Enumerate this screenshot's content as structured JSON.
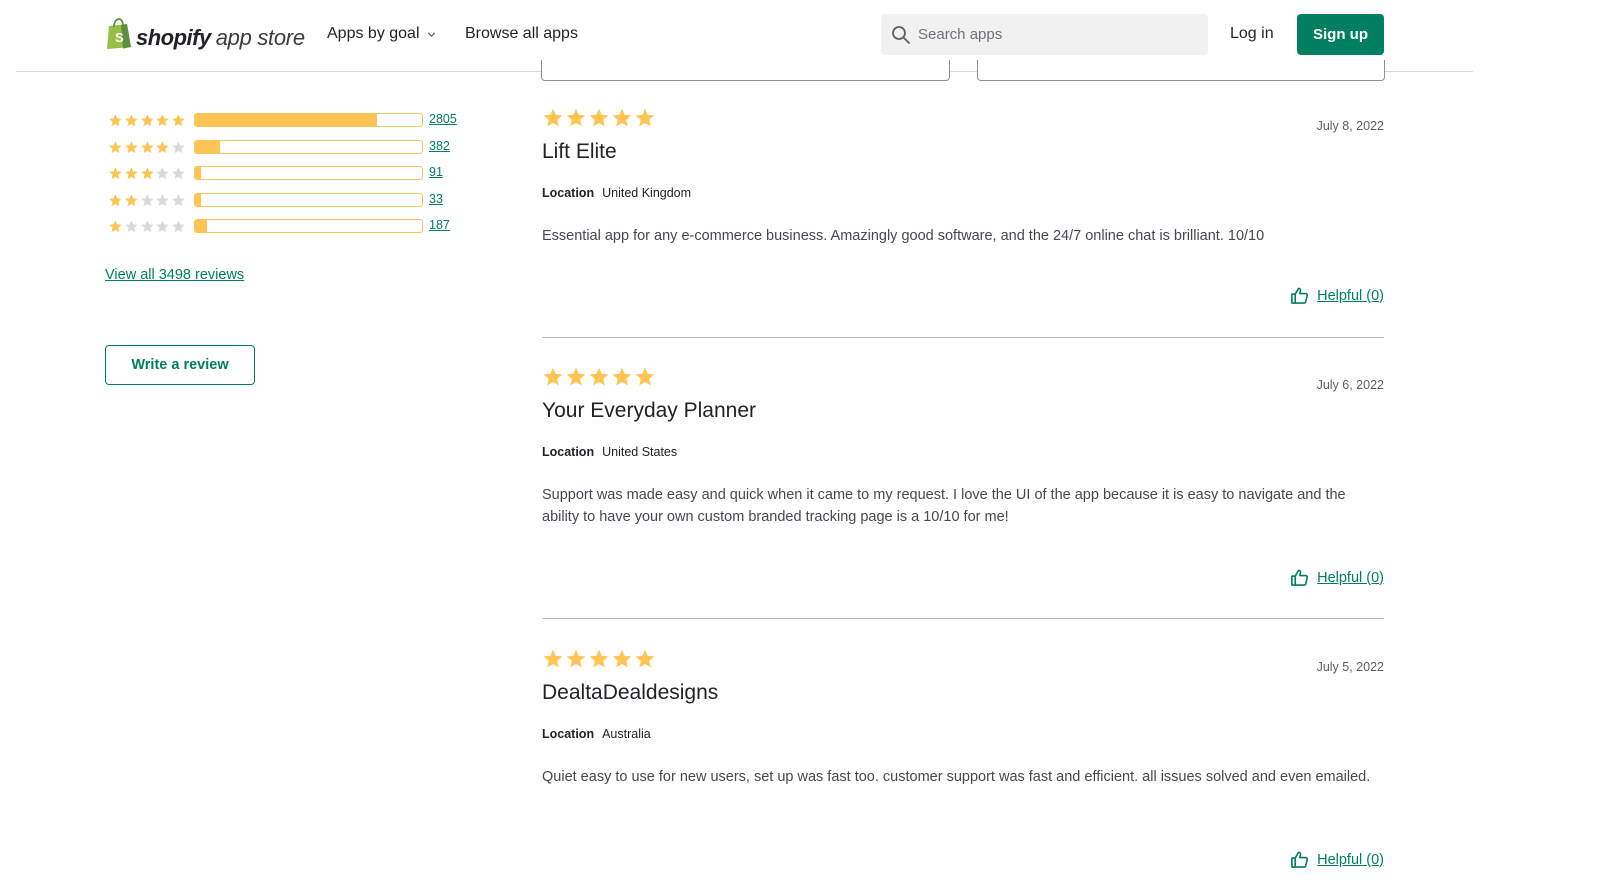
{
  "header": {
    "logo_brand": "shopify",
    "logo_sub": "app store",
    "nav_apps_by_goal": "Apps by goal",
    "nav_browse_all": "Browse all apps",
    "search_placeholder": "Search apps",
    "login_label": "Log in",
    "signup_label": "Sign up"
  },
  "colors": {
    "brand_green": "#008060",
    "star_yellow": "#ffc453",
    "star_empty": "#d9d9d9"
  },
  "ratings": {
    "rows": [
      {
        "stars": 5,
        "count": "2805",
        "fraction": 0.802
      },
      {
        "stars": 4,
        "count": "382",
        "fraction": 0.109
      },
      {
        "stars": 3,
        "count": "91",
        "fraction": 0.026
      },
      {
        "stars": 2,
        "count": "33",
        "fraction": 0.009
      },
      {
        "stars": 1,
        "count": "187",
        "fraction": 0.053
      }
    ],
    "view_all": "View all 3498 reviews",
    "write_review": "Write a review"
  },
  "reviews": [
    {
      "rating": 5,
      "date": "July 8, 2022",
      "title": "Lift Elite",
      "location_label": "Location",
      "location": "United Kingdom",
      "body": "Essential app for any e-commerce business. Amazingly good software, and the 24/7 online chat is brilliant. 10/10",
      "helpful": "Helpful (0)"
    },
    {
      "rating": 5,
      "date": "July 6, 2022",
      "title": "Your Everyday Planner",
      "location_label": "Location",
      "location": "United States",
      "body": "Support was made easy and quick when it came to my request. I love the UI of the app because it is easy to navigate and the ability to have your own custom branded tracking page is a 10/10 for me!",
      "helpful": "Helpful (0)"
    },
    {
      "rating": 5,
      "date": "July 5, 2022",
      "title": "DealtaDealdesigns",
      "location_label": "Location",
      "location": "Australia",
      "body": "Quiet easy to use for new users, set up was fast too. customer support was fast and efficient. all issues solved and even emailed.",
      "helpful": "Helpful (0)"
    }
  ]
}
